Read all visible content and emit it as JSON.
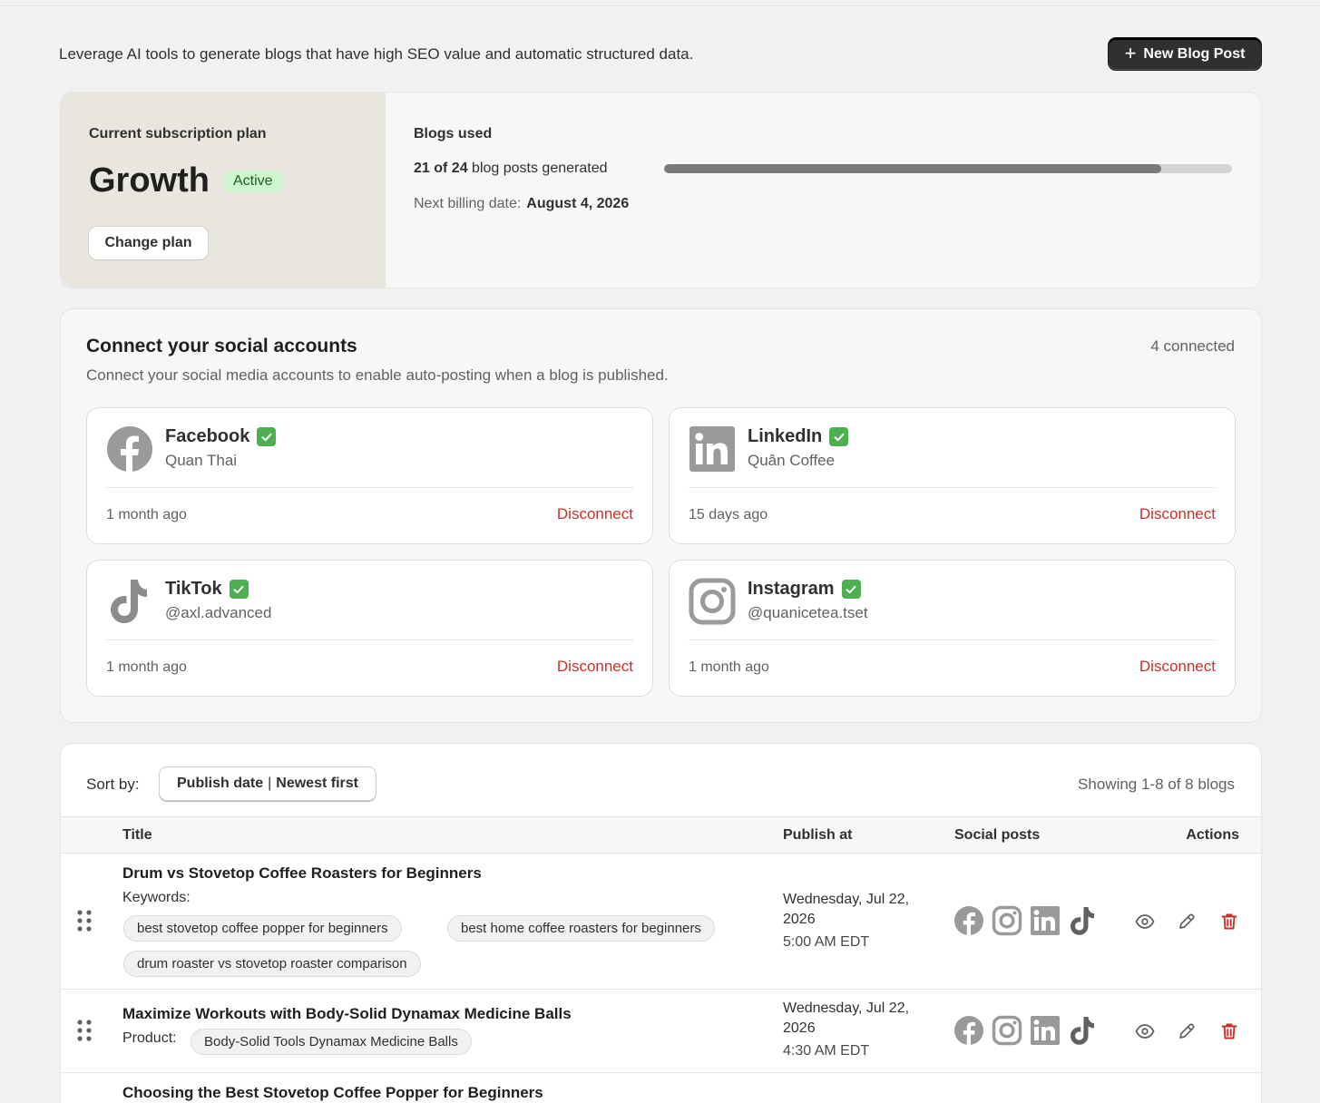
{
  "intro_text": "Leverage AI tools to generate blogs that have high SEO value and automatic structured data.",
  "new_post_label": "New Blog Post",
  "plan": {
    "caption": "Current subscription plan",
    "name": "Growth",
    "status": "Active",
    "change_label": "Change plan",
    "blogs_used_label": "Blogs used",
    "used": "21",
    "total": "24",
    "used_text": "21 of 24",
    "used_suffix": "blog posts generated",
    "progress_fraction": 0.875,
    "billing_label": "Next billing date:",
    "billing_date": "August 4, 2026"
  },
  "social": {
    "title": "Connect your social accounts",
    "subtitle": "Connect your social media accounts to enable auto-posting when a blog is published.",
    "connected_count": "4 connected",
    "accounts": [
      {
        "name": "Facebook",
        "icon": "facebook-icon",
        "handle": "Quan Thai",
        "time": "1 month ago",
        "action": "Disconnect"
      },
      {
        "name": "LinkedIn",
        "icon": "linkedin-icon",
        "handle": "Quân Coffee",
        "time": "15 days ago",
        "action": "Disconnect"
      },
      {
        "name": "TikTok",
        "icon": "tiktok-icon",
        "handle": "@axl.advanced",
        "time": "1 month ago",
        "action": "Disconnect"
      },
      {
        "name": "Instagram",
        "icon": "instagram-icon",
        "handle": "@quanicetea.tset",
        "time": "1 month ago",
        "action": "Disconnect"
      }
    ]
  },
  "blogs": {
    "sort_label": "Sort by:",
    "sort_field": "Publish date",
    "sort_order": "Newest first",
    "showing": "Showing 1-8 of 8 blogs",
    "columns": [
      "Title",
      "Publish at",
      "Social posts",
      "Actions"
    ],
    "rows": [
      {
        "title": "Drum vs Stovetop Coffee Roasters for Beginners",
        "meta_label": "Keywords:",
        "tags": [
          "best stovetop coffee popper for beginners",
          "best home coffee roasters for beginners",
          "drum roaster vs stovetop roaster comparison"
        ],
        "date": "Wednesday, Jul 22, 2026",
        "time": "5:00 AM EDT"
      },
      {
        "title": "Maximize Workouts with Body-Solid Dynamax Medicine Balls",
        "meta_label": "Product:",
        "tags": [
          "Body-Solid Tools Dynamax Medicine Balls"
        ],
        "date": "Wednesday, Jul 22, 2026",
        "time": "4:30 AM EDT"
      },
      {
        "title": "Choosing the Best Stovetop Coffee Popper for Beginners"
      }
    ]
  },
  "colors": {
    "primary_button": "#303030",
    "active_badge": "#cff5cf",
    "disconnect": "#c9302c",
    "delete": "#c9302c",
    "check": "#4caf50"
  }
}
